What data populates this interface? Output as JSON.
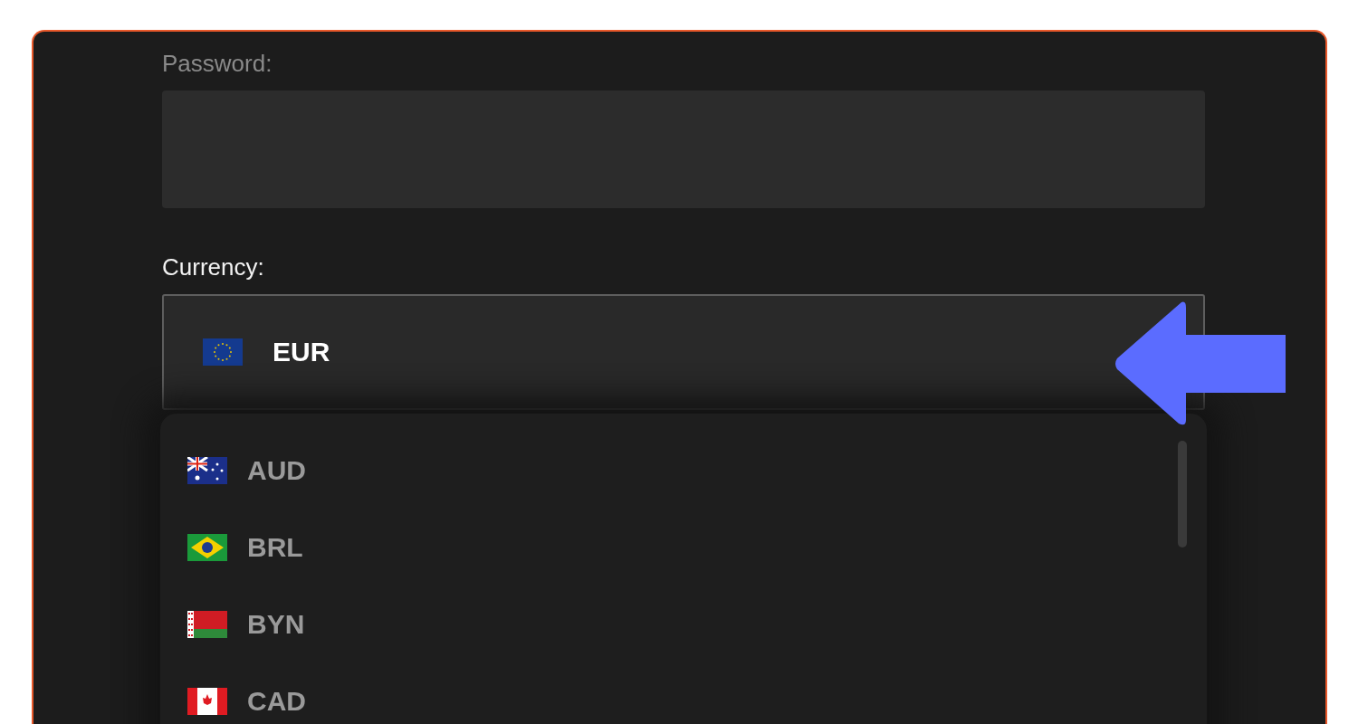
{
  "password": {
    "label": "Password:"
  },
  "currency": {
    "label": "Currency:",
    "value": {
      "code": "EUR",
      "kind": "eu"
    },
    "options": [
      {
        "code": "AUD",
        "kind": "au"
      },
      {
        "code": "BRL",
        "kind": "br"
      },
      {
        "code": "BYN",
        "kind": "by"
      },
      {
        "code": "CAD",
        "kind": "ca"
      }
    ]
  }
}
